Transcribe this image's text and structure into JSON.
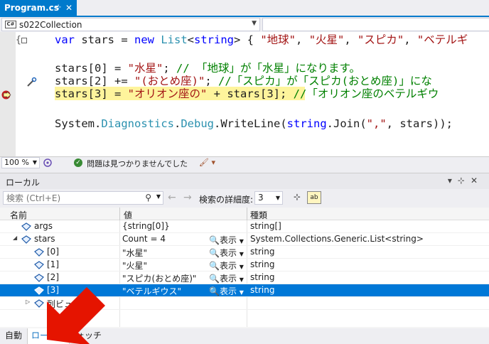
{
  "document_tab": {
    "title": "Program.cs",
    "pin_glyph": "⊹",
    "close_glyph": "✕"
  },
  "navbar": {
    "project_icon_text": "C#",
    "project": "s022Collection"
  },
  "editor": {
    "line1": {
      "kw_var": "var",
      "id_stars": " stars = ",
      "kw_new": "new",
      "sp": " ",
      "ty_list": "List",
      "lt": "<",
      "kw_string": "string",
      "rest": "> { ",
      "s1": "\"地球\"",
      "c1": ", ",
      "s2": "\"火星\"",
      "c2": ", ",
      "s3": "\"スピカ\"",
      "c3": ", ",
      "s4": "\"ベテルギ"
    },
    "line2": {
      "code": "stars[0] = ",
      "str": "\"水星\"",
      "semi": "; ",
      "cmt": "// 「地球」が「水星」になります。"
    },
    "line3": {
      "code": "stars[2] += ",
      "str": "\"(おとめ座)\"",
      "semi": "; ",
      "cmt": "//「スピカ」が「スピカ(おとめ座)」にな"
    },
    "line4": {
      "code": "stars[3] = ",
      "str": "\"オリオン座の\"",
      "code2": " + stars[3]; ",
      "cmt": "//「オリオン座のベテルギウ"
    },
    "line5": {
      "id1": "System.",
      "ty1": "Diagnostics",
      "dot1": ".",
      "ty2": "Debug",
      "dot2": ".",
      "id2": "WriteLine(",
      "kw": "string",
      "id3": ".Join(",
      "str": "\",\"",
      "id4": ", stars));"
    }
  },
  "editor_status": {
    "zoom": "100 %",
    "message": "問題は見つかりませんでした"
  },
  "locals_window": {
    "title": "ローカル",
    "search_placeholder": "検索 (Ctrl+E)",
    "search_depth_label": "検索の詳細度:",
    "search_depth_value": "3",
    "ab_label": "ab",
    "columns": {
      "name": "名前",
      "value": "値",
      "type": "種類"
    },
    "rows": [
      {
        "name": "args",
        "value": "{string[0]}",
        "viz": "表示",
        "type": "string[]"
      },
      {
        "name": "stars",
        "value": "Count = 4",
        "viz": "表示",
        "type": "System.Collections.Generic.List<string>"
      },
      {
        "name": "[0]",
        "value": "\"水星\"",
        "viz": "表示",
        "type": "string"
      },
      {
        "name": "[1]",
        "value": "\"火星\"",
        "viz": "表示",
        "type": "string"
      },
      {
        "name": "[2]",
        "value": "\"スピカ(おとめ座)\"",
        "viz": "表示",
        "type": "string"
      },
      {
        "name": "[3]",
        "value": "\"ベテルギウス\"",
        "viz": "表示",
        "type": "string"
      },
      {
        "name": "列ビュー",
        "value": "",
        "viz": "",
        "type": ""
      }
    ]
  },
  "bottom_tabs": {
    "auto": "自動",
    "locals": "ローカル",
    "watch": "ウォッチ"
  },
  "colors": {
    "accent": "#007acc",
    "selection": "#0078d7",
    "highlight": "#fef49c",
    "arrow": "#e51400"
  }
}
